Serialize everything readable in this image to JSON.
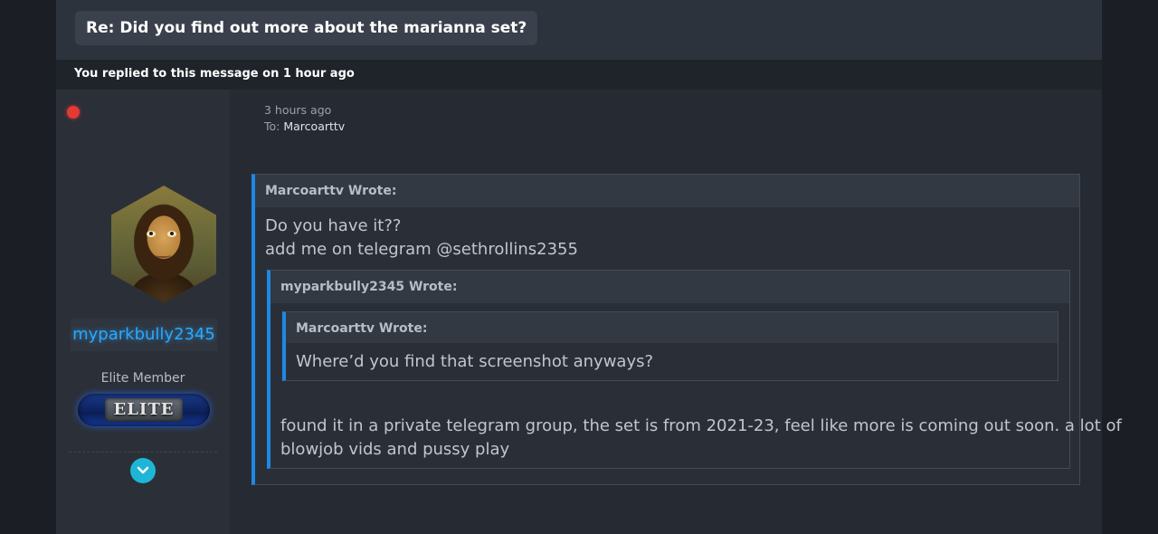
{
  "header": {
    "subject": "Re: Did you find out more about the marianna set?"
  },
  "reply_notice": "You replied to this message on 1 hour ago",
  "author": {
    "username": "myparkbully2345",
    "rank_title": "Elite Member",
    "rank_badge": "ELITE",
    "status_color": "#e53935"
  },
  "message": {
    "time": "3 hours ago",
    "to_label": "To:",
    "to_name": "Marcoarttv"
  },
  "quote_outer": {
    "header": "Marcoarttv Wrote:",
    "lines": [
      "Do you have it??",
      "add me on telegram @sethrollins2355"
    ]
  },
  "quote_middle": {
    "header": "myparkbully2345 Wrote:",
    "reply_lines": [
      "found it in a private telegram group, the set is from 2021-23, feel like more is coming out soon. a lot of",
      "blowjob vids and pussy play"
    ]
  },
  "quote_inner": {
    "header": "Marcoarttv Wrote:",
    "text": "Where’d you find that screenshot anyways?"
  },
  "colors": {
    "accent": "#1e88e5",
    "username": "#2aa8ff",
    "expand_button": "#1eb6d6"
  }
}
